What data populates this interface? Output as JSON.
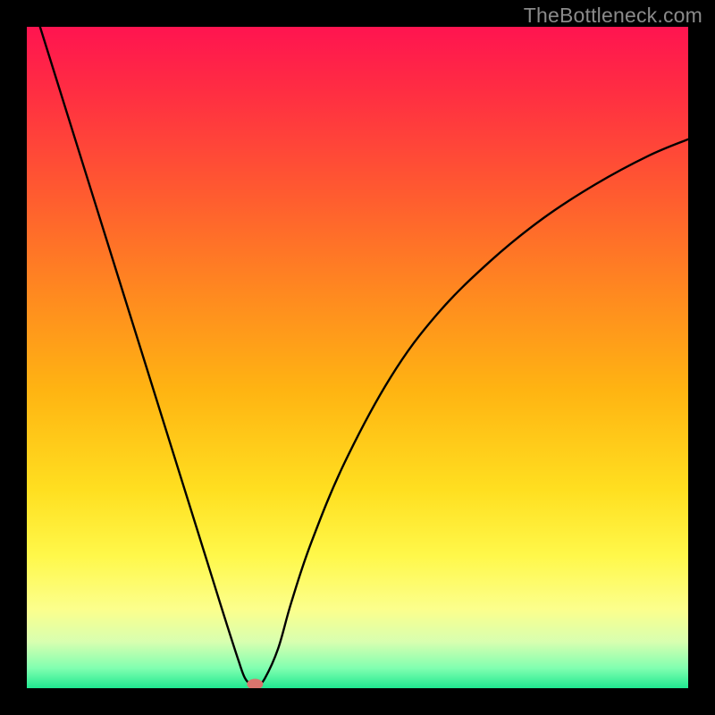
{
  "watermark": "TheBottleneck.com",
  "chart_data": {
    "type": "line",
    "title": "",
    "xlabel": "",
    "ylabel": "",
    "xlim": [
      0,
      100
    ],
    "ylim": [
      0,
      100
    ],
    "grid": false,
    "legend": false,
    "background_gradient_stops": [
      {
        "offset": 0.0,
        "color": "#ff1450"
      },
      {
        "offset": 0.1,
        "color": "#ff2e42"
      },
      {
        "offset": 0.25,
        "color": "#ff5a30"
      },
      {
        "offset": 0.4,
        "color": "#ff8820"
      },
      {
        "offset": 0.55,
        "color": "#ffb412"
      },
      {
        "offset": 0.7,
        "color": "#ffdf20"
      },
      {
        "offset": 0.8,
        "color": "#fff84a"
      },
      {
        "offset": 0.88,
        "color": "#fcff8c"
      },
      {
        "offset": 0.93,
        "color": "#d8ffb0"
      },
      {
        "offset": 0.97,
        "color": "#80ffb0"
      },
      {
        "offset": 1.0,
        "color": "#20e890"
      }
    ],
    "series": [
      {
        "name": "curve",
        "x": [
          2,
          5,
          10,
          15,
          20,
          25,
          28,
          30,
          32,
          33,
          34,
          35,
          36,
          38,
          40,
          43,
          48,
          55,
          62,
          70,
          78,
          86,
          94,
          100
        ],
        "y": [
          100,
          90.4,
          74.4,
          58.4,
          42.4,
          26.4,
          16.8,
          10.4,
          4.2,
          1.5,
          0.6,
          0.6,
          1.5,
          6.0,
          13.0,
          22.0,
          34.0,
          47.0,
          56.5,
          64.5,
          71.0,
          76.2,
          80.5,
          83.0
        ]
      }
    ],
    "marker": {
      "x": 34.5,
      "y": 0.6,
      "color": "#d9746d",
      "rx": 9,
      "ry": 6
    }
  }
}
